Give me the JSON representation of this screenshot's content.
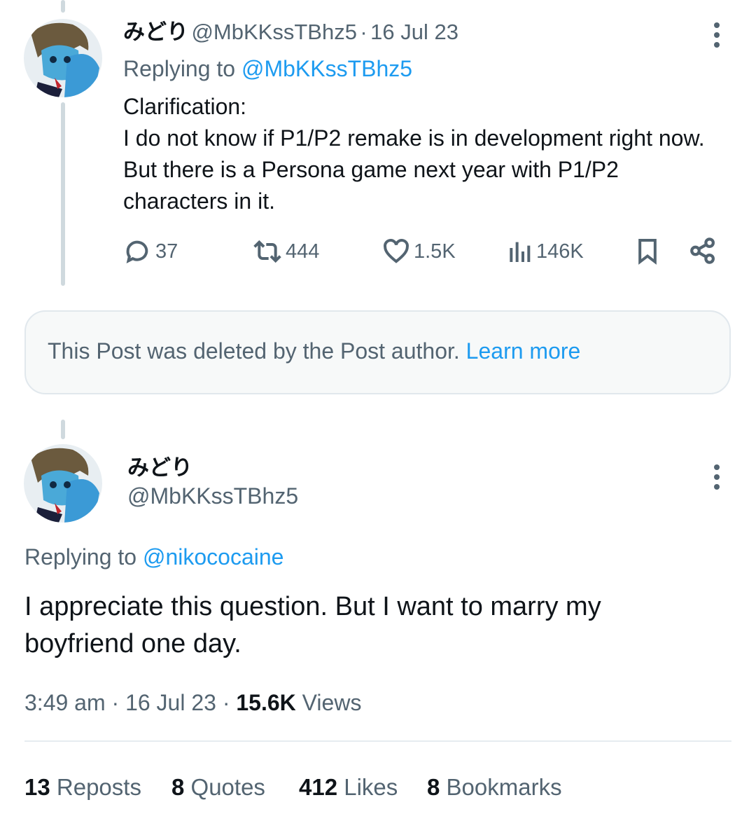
{
  "tweet1": {
    "display_name": "みどり",
    "handle": "@MbKKssTBhz5",
    "date_sep": "·",
    "date": "16 Jul 23",
    "replying_prefix": "Replying to",
    "replying_handle": "@MbKKssTBhz5",
    "lines": [
      "Clarification:",
      "I do not know if P1/P2 remake is in development right now.",
      "But there is a Persona game next year with P1/P2",
      "characters in it."
    ],
    "actions": {
      "replies": "37",
      "reposts": "444",
      "likes": "1.5K",
      "views": "146K"
    }
  },
  "deleted_notice": {
    "text": "This Post was deleted by the Post author.",
    "link": "Learn more"
  },
  "tweet2": {
    "display_name": "みどり",
    "handle": "@MbKKssTBhz5",
    "replying_prefix": "Replying to",
    "replying_handle": "@nikococaine",
    "lines": [
      "I appreciate this question. But I want to marry my",
      "boyfriend one day."
    ],
    "meta": {
      "time": "3:49 am",
      "sep1": "·",
      "date": "16 Jul 23",
      "sep2": "·",
      "views_count": "15.6K",
      "views_label": "Views"
    },
    "stats": {
      "reposts_count": "13",
      "reposts_label": "Reposts",
      "quotes_count": "8",
      "quotes_label": "Quotes",
      "likes_count": "412",
      "likes_label": "Likes",
      "bookmarks_count": "8",
      "bookmarks_label": "Bookmarks"
    }
  },
  "icons": {
    "reply": "reply-icon",
    "repost": "repost-icon",
    "like": "heart-icon",
    "views": "views-icon",
    "bookmark": "bookmark-icon",
    "share": "share-icon",
    "more": "more-icon"
  },
  "colors": {
    "accent": "#1d9bf0",
    "secondary_text": "#536471",
    "primary_text": "#0f1419",
    "thread_line": "#cfd9de"
  }
}
